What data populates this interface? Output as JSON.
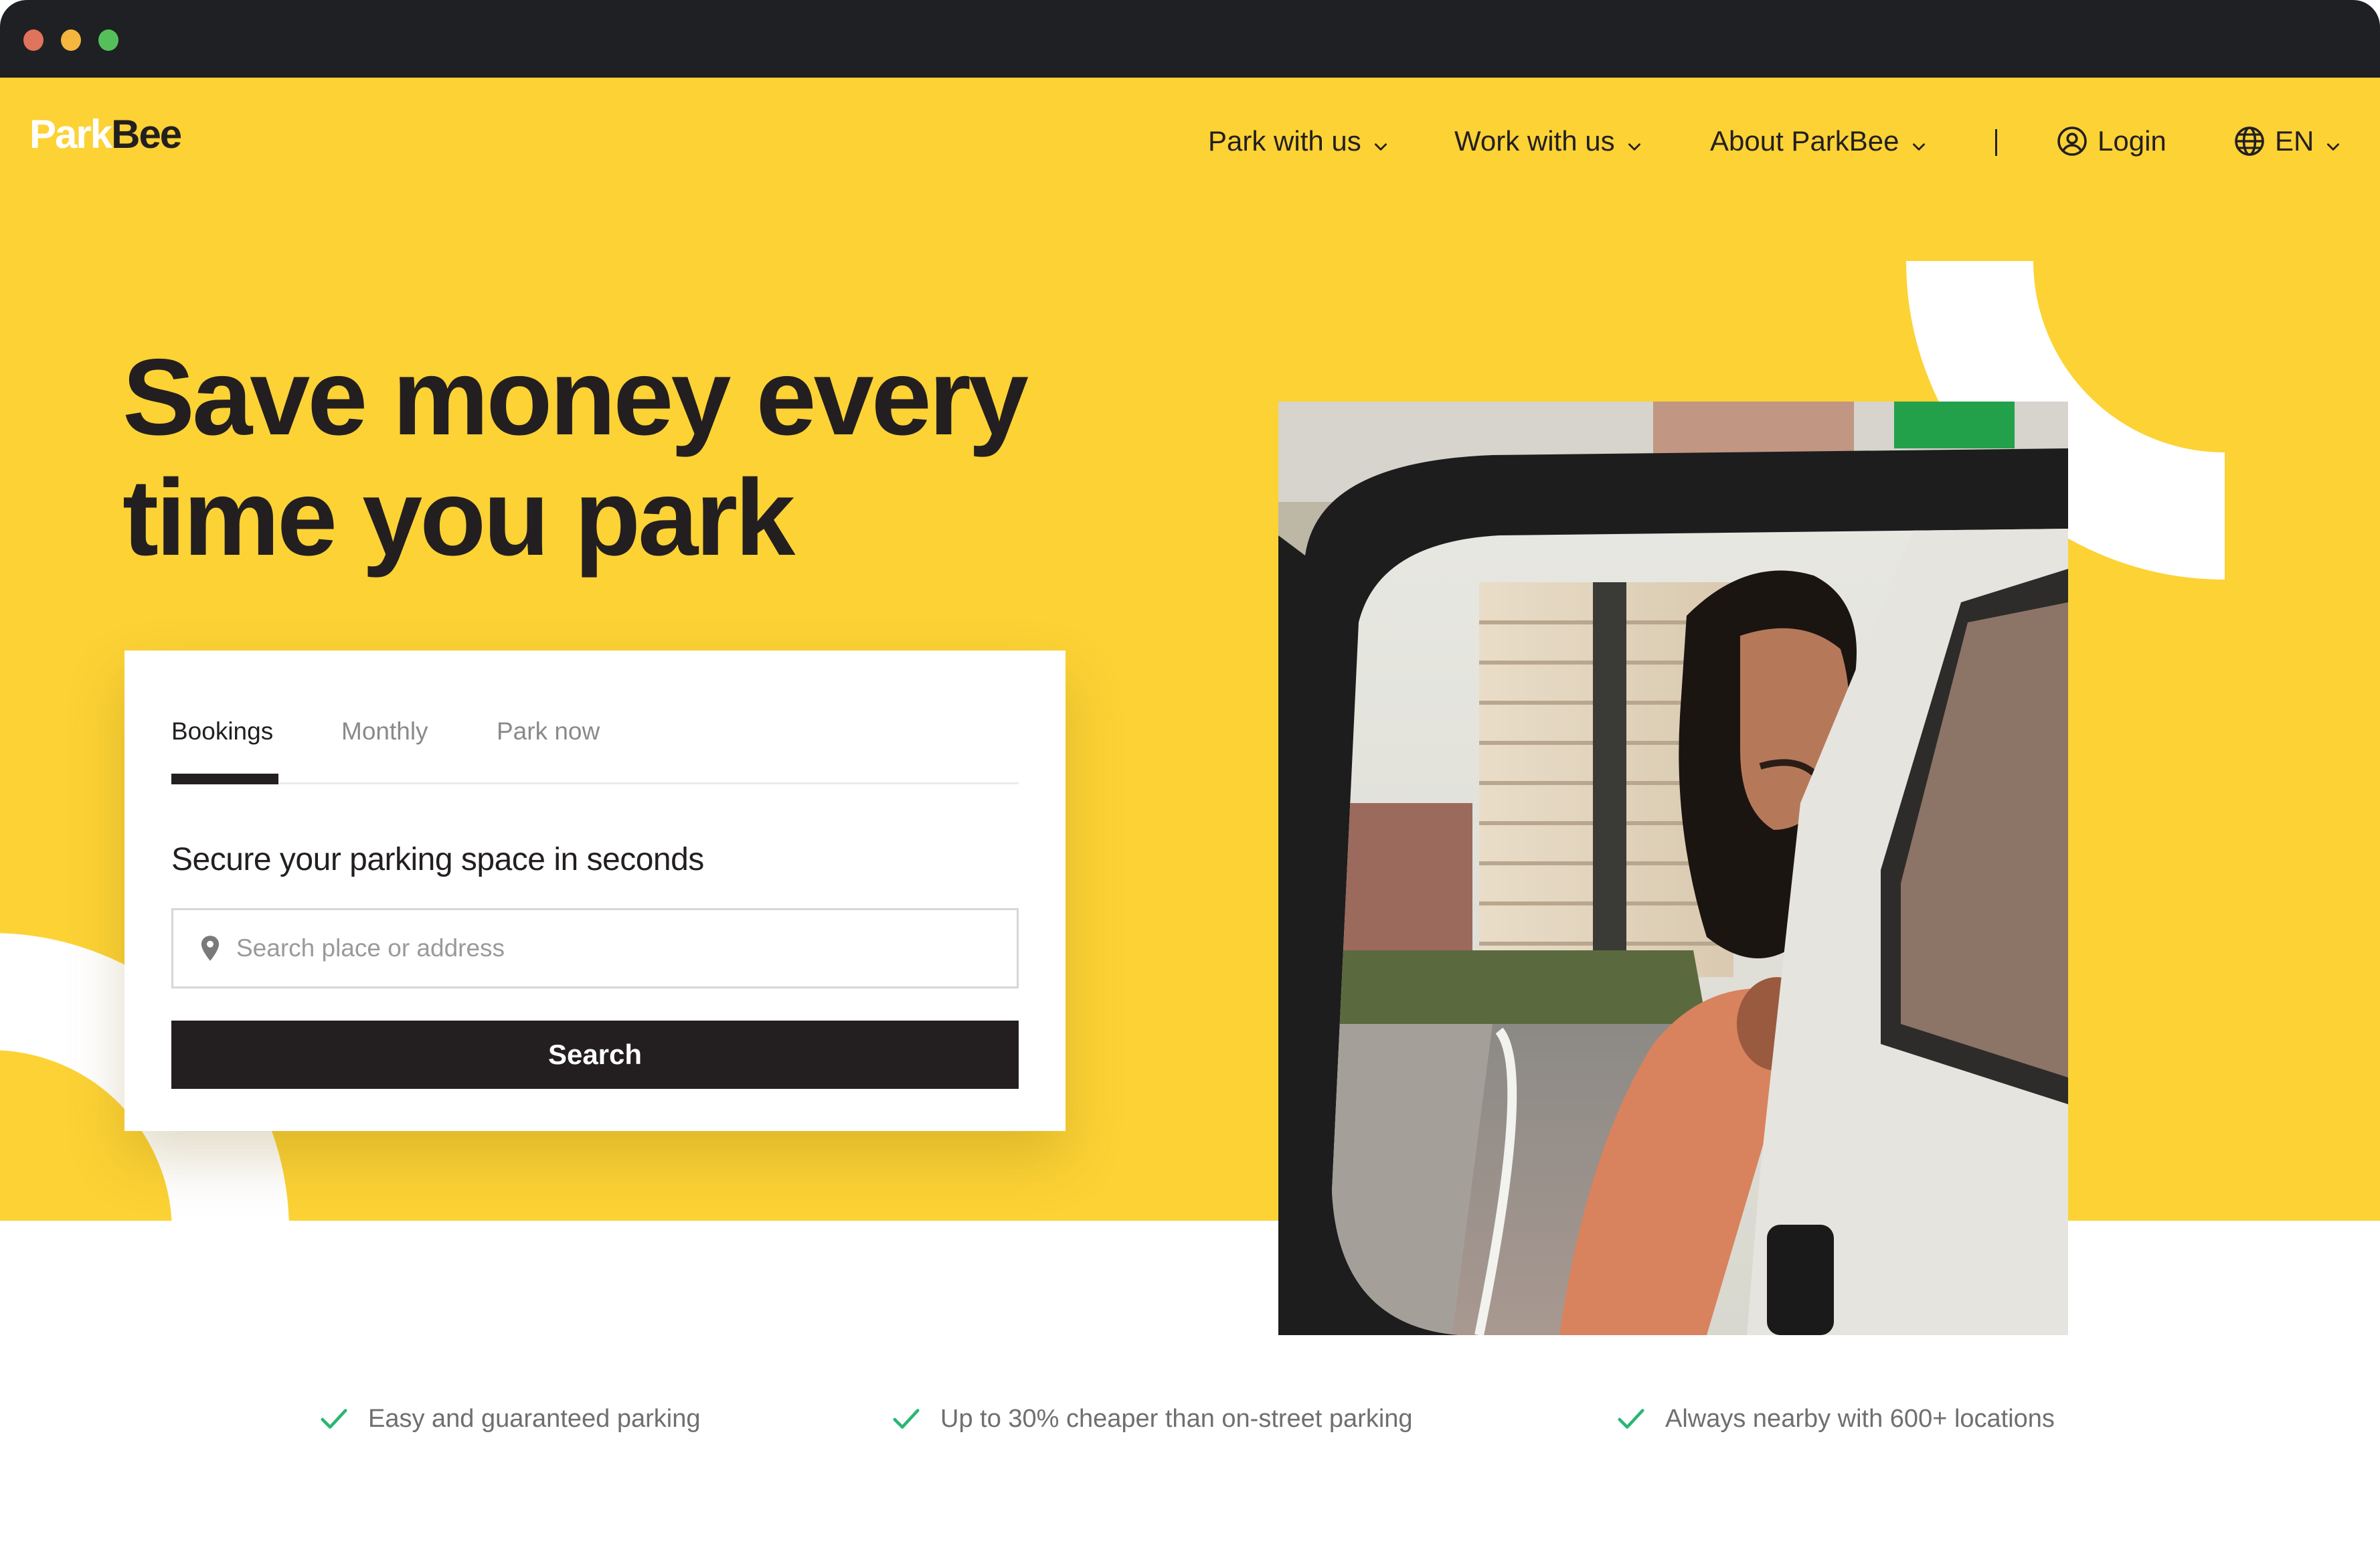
{
  "window": {
    "controls": [
      "close",
      "minimize",
      "maximize"
    ]
  },
  "header": {
    "logo": {
      "part1": "Park",
      "part2": "Bee"
    },
    "nav": [
      {
        "label": "Park with us",
        "has_dropdown": true
      },
      {
        "label": "Work with us",
        "has_dropdown": true
      },
      {
        "label": "About ParkBee",
        "has_dropdown": true
      }
    ],
    "login": {
      "label": "Login",
      "icon": "user-circle-icon"
    },
    "language": {
      "label": "EN",
      "icon": "globe-icon",
      "has_dropdown": true
    }
  },
  "hero": {
    "headline_line1": "Save money every",
    "headline_line2": "time you park",
    "image_alt": "Man leaning out of a car window reflected in a side mirror"
  },
  "booking_card": {
    "tabs": [
      {
        "label": "Bookings",
        "active": true
      },
      {
        "label": "Monthly",
        "active": false
      },
      {
        "label": "Park now",
        "active": false
      }
    ],
    "heading": "Secure your parking space in seconds",
    "search": {
      "placeholder": "Search place or address",
      "value": "",
      "icon": "location-pin-icon"
    },
    "submit_label": "Search"
  },
  "features": [
    {
      "icon": "check-icon",
      "text": "Easy and guaranteed parking"
    },
    {
      "icon": "check-icon",
      "text": "Up to 30% cheaper than on-street parking"
    },
    {
      "icon": "check-icon",
      "text": "Always nearby with 600+ locations"
    }
  ],
  "colors": {
    "brand_yellow": "#fcd235",
    "ink": "#231f20",
    "check_green": "#2bb673",
    "titlebar": "#1f2023"
  }
}
